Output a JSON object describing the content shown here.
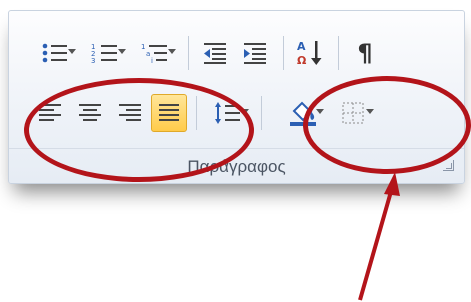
{
  "ribbon": {
    "group_label": "Παράγραφος",
    "row1": [
      {
        "name": "bullets",
        "label": ""
      },
      {
        "name": "numbering",
        "label": ""
      },
      {
        "name": "multilevel-list",
        "label": ""
      },
      {
        "name": "decrease-indent",
        "label": ""
      },
      {
        "name": "increase-indent",
        "label": ""
      },
      {
        "name": "sort",
        "label": ""
      },
      {
        "name": "show-hide-marks",
        "label": "¶"
      }
    ],
    "row2": [
      {
        "name": "align-left"
      },
      {
        "name": "align-center"
      },
      {
        "name": "align-right"
      },
      {
        "name": "justify",
        "active": true
      },
      {
        "name": "line-spacing"
      },
      {
        "name": "shading"
      },
      {
        "name": "borders"
      }
    ]
  },
  "annotations": {
    "color": "#b3141a"
  },
  "colors": {
    "active_button": "#ffcb4a",
    "ribbon_bg": "#eef2f8"
  }
}
